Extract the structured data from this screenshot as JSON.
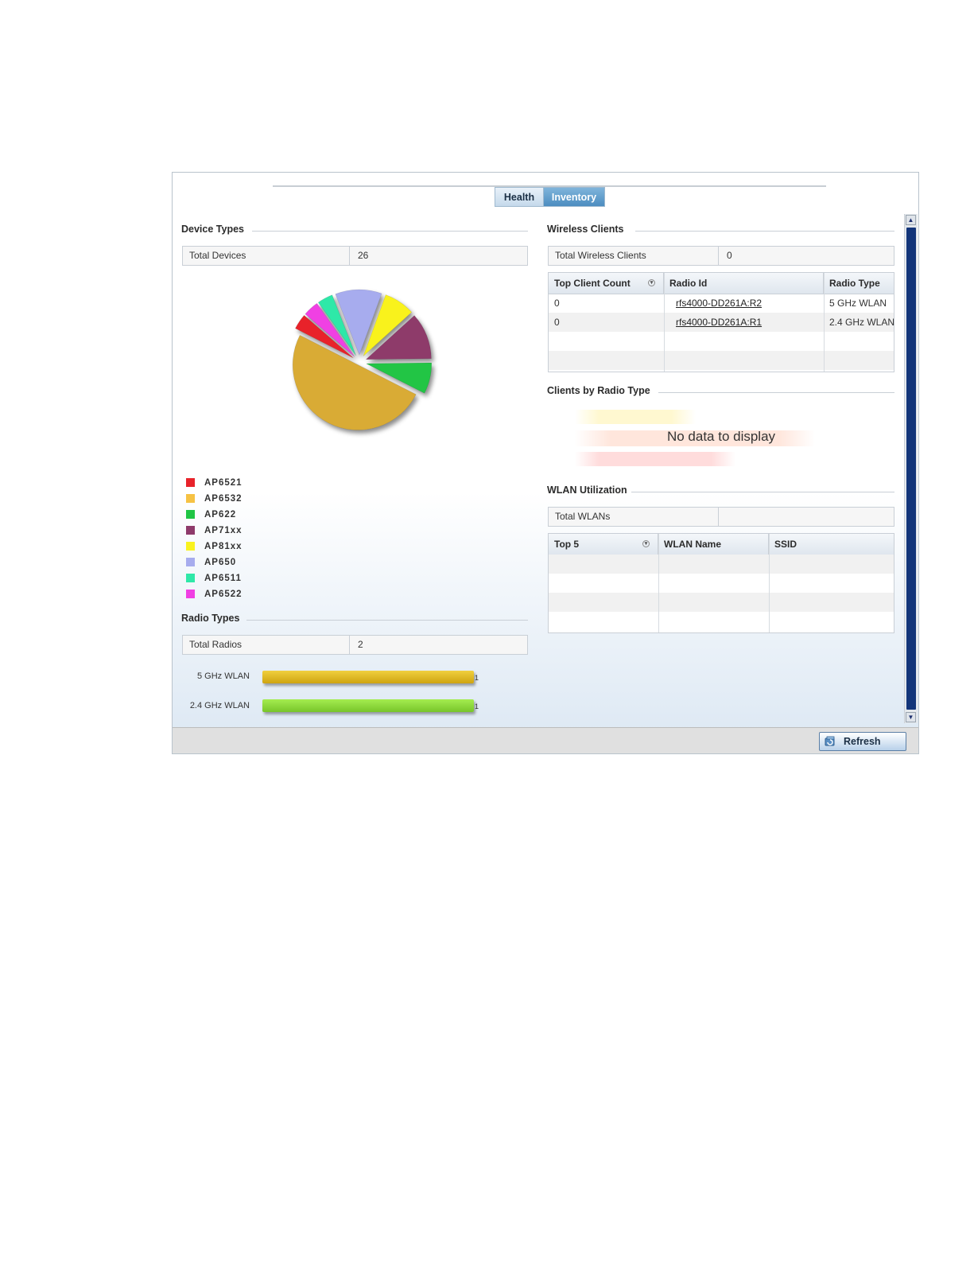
{
  "tabs": {
    "health": "Health",
    "inventory": "Inventory"
  },
  "device_types": {
    "title": "Device Types",
    "total_label": "Total Devices",
    "total_value": "26",
    "legend": [
      {
        "label": "AP6521",
        "color": "#e8232a"
      },
      {
        "label": "AP6532",
        "color": "#f6c244"
      },
      {
        "label": "AP622",
        "color": "#20c545"
      },
      {
        "label": "AP71xx",
        "color": "#8e3a6b"
      },
      {
        "label": "AP81xx",
        "color": "#f9f21f"
      },
      {
        "label": "AP650",
        "color": "#a7acee"
      },
      {
        "label": "AP6511",
        "color": "#2fe8a8"
      },
      {
        "label": "AP6522",
        "color": "#f03fe3"
      }
    ]
  },
  "chart_data": {
    "type": "pie",
    "categories": [
      "AP6521",
      "AP6532",
      "AP622",
      "AP71xx",
      "AP81xx",
      "AP650",
      "AP6511",
      "AP6522"
    ],
    "values": [
      1,
      13,
      2,
      3,
      2,
      3,
      1,
      1
    ],
    "colors": [
      "#e8232a",
      "#d9ab35",
      "#20c545",
      "#8e3a6b",
      "#f9f21f",
      "#a7acee",
      "#2fe8a8",
      "#f03fe3"
    ],
    "total": 26
  },
  "radio_types": {
    "title": "Radio Types",
    "total_label": "Total Radios",
    "total_value": "2",
    "bars": [
      {
        "label": "5 GHz WLAN",
        "value": 1,
        "color": "#e0b61c"
      },
      {
        "label": "2.4 GHz WLAN",
        "value": 1,
        "color": "#8ed83a"
      }
    ]
  },
  "wireless_clients": {
    "title": "Wireless Clients",
    "total_label": "Total Wireless Clients",
    "total_value": "0",
    "columns": [
      "Top Client Count",
      "Radio Id",
      "Radio Type"
    ],
    "rows": [
      {
        "count": "0",
        "radio_id": "rfs4000-DD261A:R2",
        "radio_type": "5 GHz WLAN"
      },
      {
        "count": "0",
        "radio_id": "rfs4000-DD261A:R1",
        "radio_type": "2.4 GHz WLAN"
      }
    ]
  },
  "clients_by_radio": {
    "title": "Clients by Radio Type",
    "empty_text": "No data to display"
  },
  "wlan_utilization": {
    "title": "WLAN Utilization",
    "total_label": "Total WLANs",
    "total_value": "",
    "columns": [
      "Top 5",
      "WLAN Name",
      "SSID"
    ]
  },
  "footer": {
    "refresh_label": "Refresh"
  }
}
